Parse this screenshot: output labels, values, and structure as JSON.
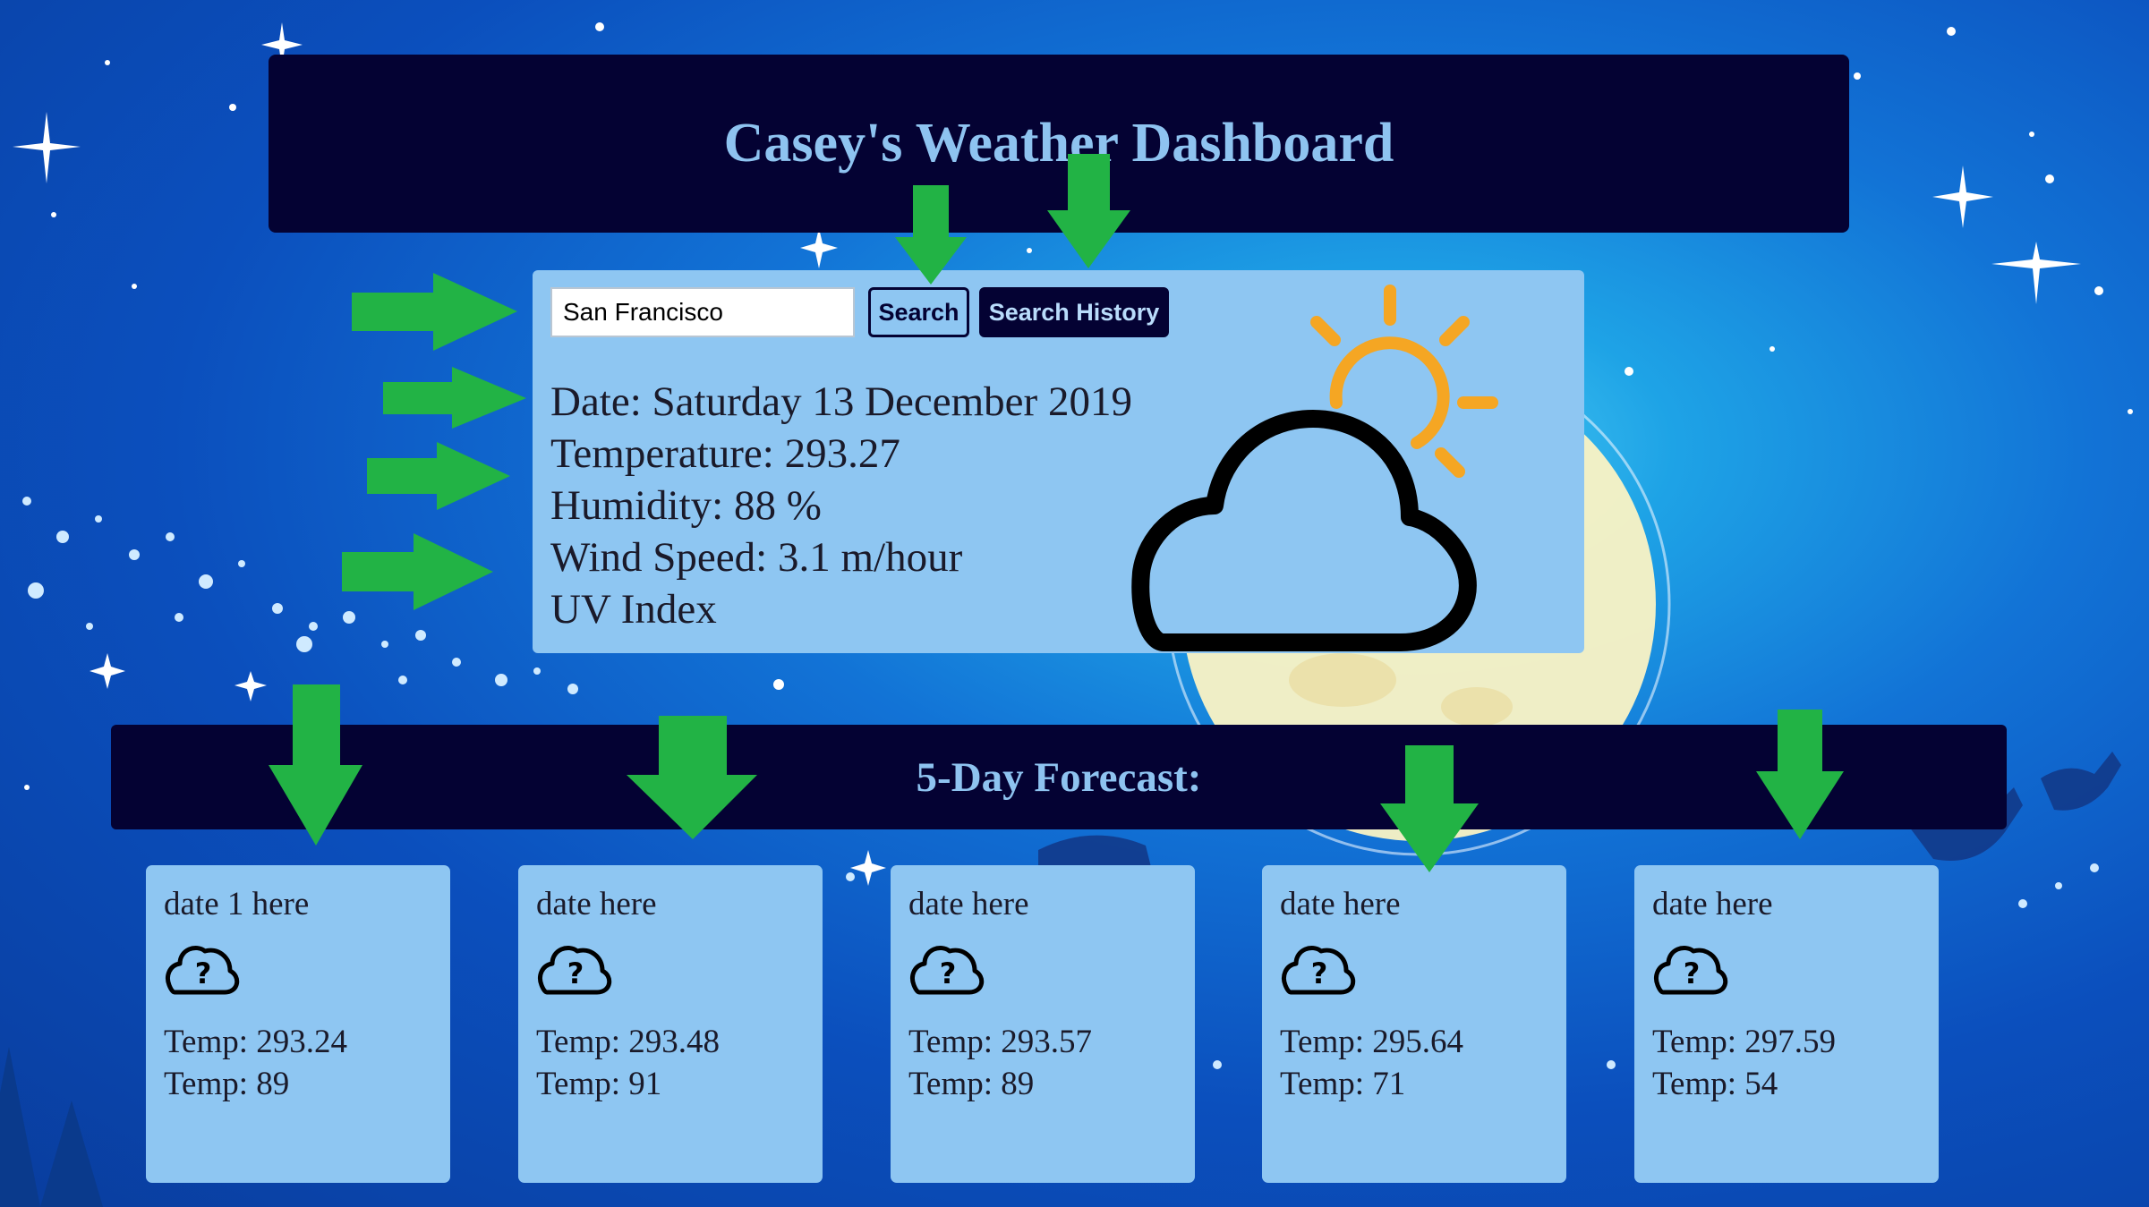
{
  "header": {
    "title": "Casey's Weather Dashboard"
  },
  "search": {
    "value": "San Francisco",
    "search_label": "Search",
    "history_label": "Search History"
  },
  "current": {
    "date": "Date: Saturday 13 December 2019",
    "temperature": "Temperature: 293.27",
    "humidity": "Humidity: 88 %",
    "wind": "Wind Speed: 3.1 m/hour",
    "uv": "UV Index",
    "icon": "partly-cloudy-icon"
  },
  "forecast": {
    "title": "5-Day Forecast:",
    "cards": [
      {
        "date": "date 1 here",
        "icon": "cloud-question-icon",
        "temp": "Temp: 293.24",
        "humidity": "Temp: 89"
      },
      {
        "date": "date here",
        "icon": "cloud-question-icon",
        "temp": "Temp: 293.48",
        "humidity": "Temp: 91"
      },
      {
        "date": "date here",
        "icon": "cloud-question-icon",
        "temp": "Temp: 293.57",
        "humidity": "Temp: 89"
      },
      {
        "date": "date here",
        "icon": "cloud-question-icon",
        "temp": "Temp: 295.64",
        "humidity": "Temp: 71"
      },
      {
        "date": "date here",
        "icon": "cloud-question-icon",
        "temp": "Temp: 297.59",
        "humidity": "Temp: 54"
      }
    ]
  },
  "colors": {
    "panel": "#8ec6f2",
    "header_bg": "#040233",
    "header_text": "#8ec3f0",
    "arrow": "#22b345",
    "sun": "#f5a623"
  }
}
